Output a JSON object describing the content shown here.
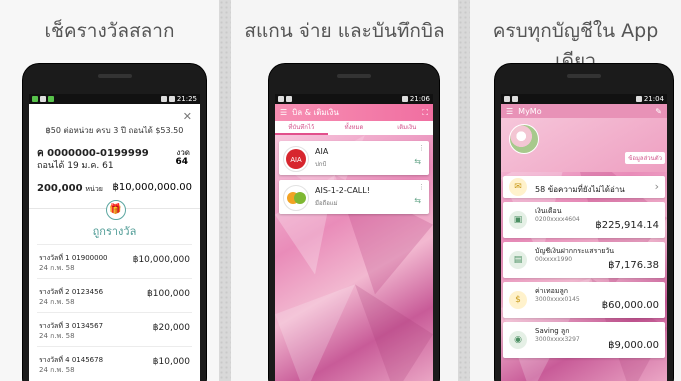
{
  "screens": [
    {
      "caption": "เช็ครางวัลสลาก",
      "status": {
        "time": "21:25"
      },
      "lottery": {
        "note": "฿50 ต่อหน่วย ครบ 3 ปี ถอนได้ $53.50",
        "number_range": "ค  0000000-0199999",
        "withdraw_date": "ถอนได้ 19 ม.ค. 61",
        "period_label": "งวด",
        "period_value": "64",
        "qty": "200,000",
        "qty_unit": "หน่วย",
        "total_prize": "฿10,000,000.00",
        "check_label": "ถูกรางวัล",
        "items": [
          {
            "title": "รางวัลที่ 1  01900000",
            "date": "24 ก.พ. 58",
            "amount": "฿10,000,000"
          },
          {
            "title": "รางวัลที่ 2  0123456",
            "date": "24 ก.พ. 58",
            "amount": "฿100,000"
          },
          {
            "title": "รางวัลที่ 3  0134567",
            "date": "24 ก.พ. 58",
            "amount": "฿20,000"
          },
          {
            "title": "รางวัลที่ 4  0145678",
            "date": "24 ก.พ. 58",
            "amount": "฿10,000"
          }
        ]
      }
    },
    {
      "caption": "สแกน จ่าย และบันทึกบิล",
      "status": {
        "time": "21:06"
      },
      "bills": {
        "title": "บิล & เติมเงิน",
        "tabs": [
          "ที่บันทึกไว้",
          "ทั้งหมด",
          "เติมเงิน"
        ],
        "cards": [
          {
            "name": "AIA",
            "sub": "ปกป้"
          },
          {
            "name": "AIS-1-2-CALL!",
            "sub": "มือถือแม่"
          }
        ]
      }
    },
    {
      "caption": "ครบทุกบัญชีใน App เดียว",
      "status": {
        "time": "21:04"
      },
      "mymo": {
        "title": "MyMo",
        "edit_info": "ข้อมูลส่วนตัว",
        "messages": "58 ข้อความที่ยังไม่ได้อ่าน",
        "accounts": [
          {
            "name": "เงินเดือน",
            "no": "0200xxxx4604",
            "amount": "฿225,914.14"
          },
          {
            "name": "บัญชีเงินฝากกระแสรายวัน",
            "no": "00xxxx1990",
            "amount": "฿7,176.38"
          },
          {
            "name": "ค่าเทอมลูก",
            "no": "3000xxxx0145",
            "amount": "฿60,000.00"
          },
          {
            "name": "Saving ลูก",
            "no": "3000xxxx3297",
            "amount": "฿9,000.00"
          }
        ]
      }
    }
  ],
  "colors": {
    "pink": "#f07aa8",
    "teal": "#5ba6a0"
  }
}
